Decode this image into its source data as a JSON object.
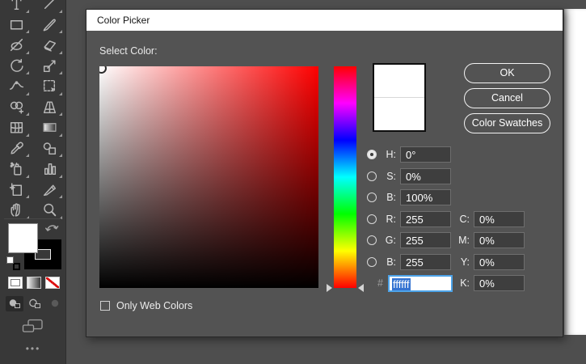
{
  "window": {
    "title": "Color Picker"
  },
  "dialog": {
    "select_color_label": "Select Color:",
    "buttons": {
      "ok": "OK",
      "cancel": "Cancel",
      "color_swatches": "Color Swatches"
    },
    "checkbox_label": "Only Web Colors",
    "hsb": [
      {
        "label": "H:",
        "value": "0°",
        "selected": true
      },
      {
        "label": "S:",
        "value": "0%",
        "selected": false
      },
      {
        "label": "B:",
        "value": "100%",
        "selected": false
      }
    ],
    "rgb": [
      {
        "label": "R:",
        "value": "255",
        "selected": false
      },
      {
        "label": "G:",
        "value": "255",
        "selected": false
      },
      {
        "label": "B:",
        "value": "255",
        "selected": false
      }
    ],
    "cmyk": [
      {
        "label": "C:",
        "value": "0%"
      },
      {
        "label": "M:",
        "value": "0%"
      },
      {
        "label": "Y:",
        "value": "0%"
      },
      {
        "label": "K:",
        "value": "0%"
      }
    ],
    "hex": {
      "label": "#",
      "value": "ffffff"
    }
  },
  "toolbar": {
    "ellipsis": "•••",
    "tools": [
      "type",
      "line-segment",
      "rectangle",
      "paintbrush",
      "shaper",
      "eraser",
      "rotate",
      "scale",
      "width",
      "free-transform",
      "shape-builder",
      "perspective-grid",
      "mesh",
      "gradient",
      "eyedropper",
      "blend",
      "symbol-sprayer",
      "column-graph",
      "artboard",
      "slice",
      "hand",
      "zoom"
    ]
  },
  "colors": {
    "dialog_bg": "#535353",
    "titlebar_bg": "#ffffff",
    "app_bg": "#4e4e4e",
    "toolbar_bg": "#383838",
    "field_bg": "#3e3e3e",
    "field_border": "#6e6e6e",
    "selection_blue": "#3473d1",
    "focus_border_blue": "#4da3e8",
    "none_red": "#dd1111",
    "hue_base": "#ff0000",
    "swatch_new": "#ffffff",
    "swatch_current": "#ffffff"
  }
}
